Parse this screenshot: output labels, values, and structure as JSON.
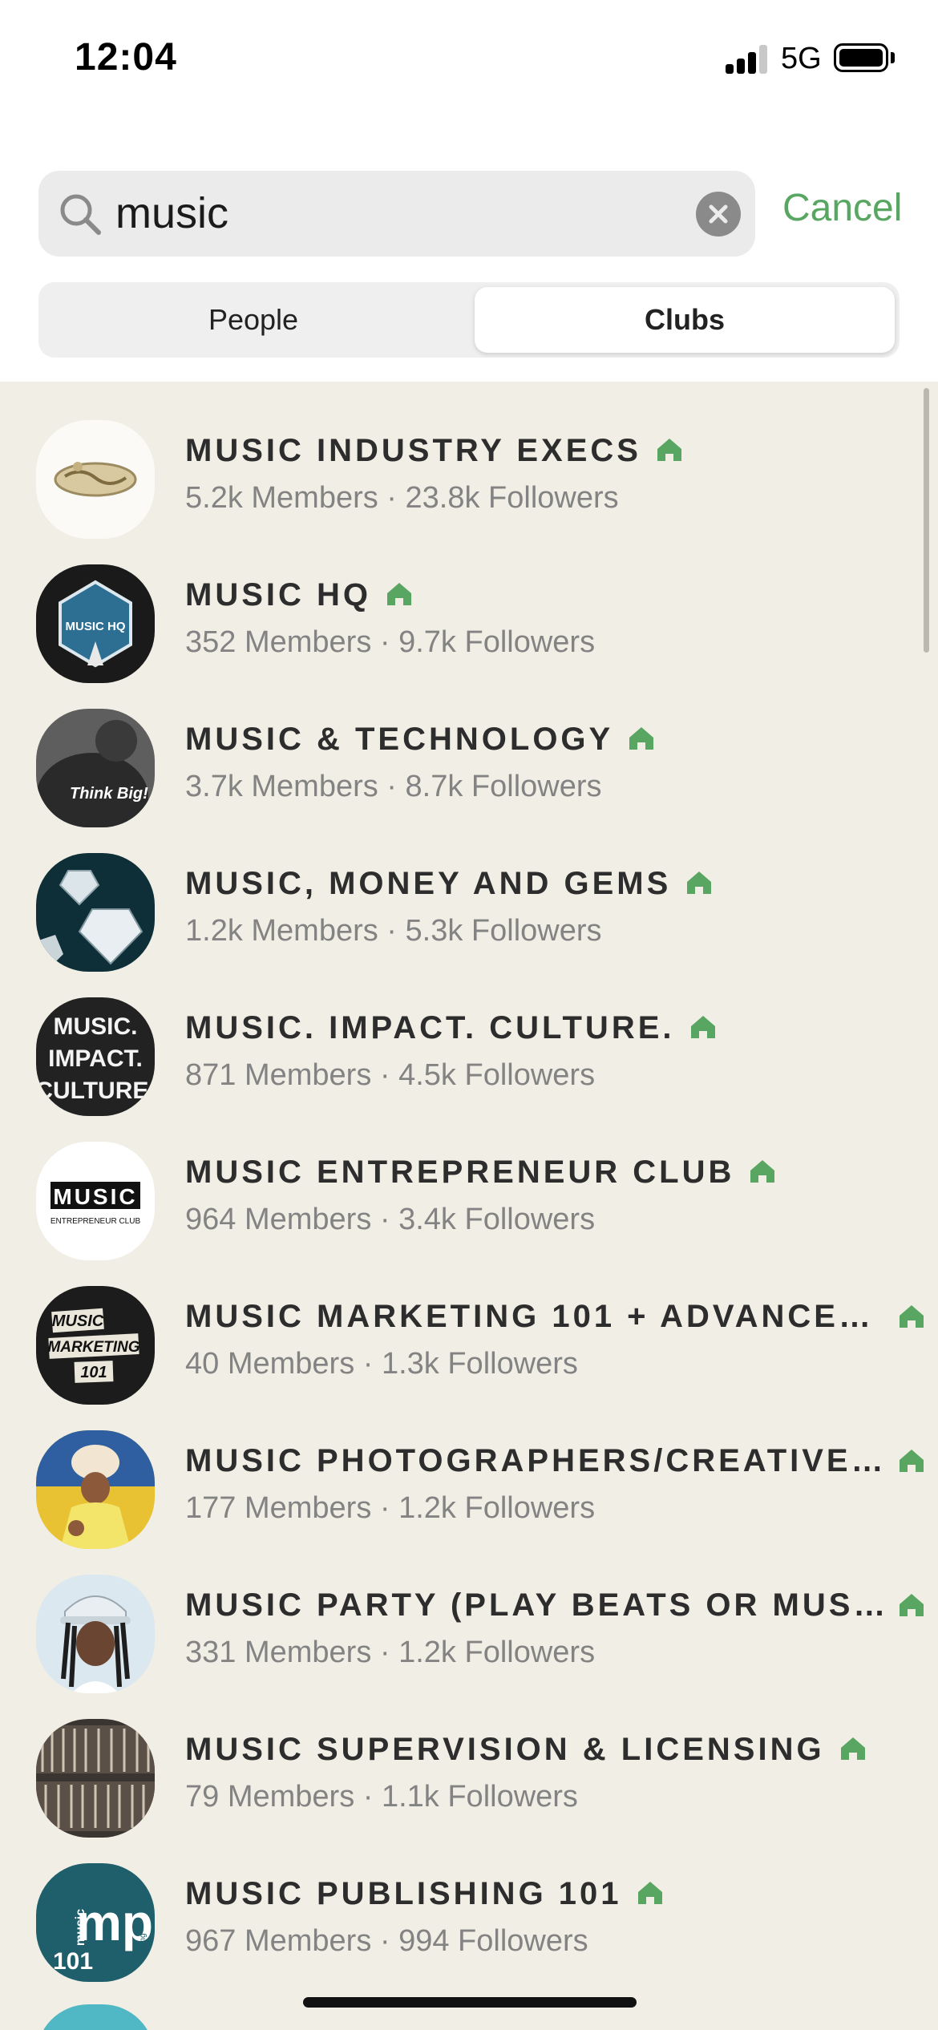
{
  "status_bar": {
    "time": "12:04",
    "network": "5G",
    "signal_bars_filled": 3,
    "battery_icon": "battery-full-icon"
  },
  "search": {
    "value": "music",
    "icon": "search-icon",
    "clear_icon": "clear-icon",
    "cancel_label": "Cancel"
  },
  "tabs": {
    "people": "People",
    "clubs": "Clubs",
    "selected": "Clubs"
  },
  "colors": {
    "accent": "#58A661",
    "background": "#F1EFE5"
  },
  "clubs": [
    {
      "name": "MUSIC INDUSTRY EXECS",
      "stats": "5.2k Members · 23.8k Followers"
    },
    {
      "name": "MUSIC HQ",
      "stats": "352 Members · 9.7k Followers"
    },
    {
      "name": "MUSIC & TECHNOLOGY",
      "stats": "3.7k Members · 8.7k Followers"
    },
    {
      "name": "MUSIC, MONEY AND GEMS",
      "stats": "1.2k Members · 5.3k Followers"
    },
    {
      "name": "MUSIC. IMPACT. CULTURE.",
      "stats": "871 Members · 4.5k Followers"
    },
    {
      "name": "MUSIC ENTREPRENEUR CLUB",
      "stats": "964 Members · 3.4k Followers"
    },
    {
      "name": "MUSIC MARKETING 101 + ADVANCE…",
      "stats": "40 Members · 1.3k Followers"
    },
    {
      "name": "MUSIC PHOTOGRAPHERS/CREATIVE…",
      "stats": "177 Members · 1.2k Followers"
    },
    {
      "name": "MUSIC PARTY (PLAY BEATS OR MUSI…",
      "stats": "331 Members · 1.2k Followers"
    },
    {
      "name": "MUSIC SUPERVISION & LICENSING",
      "stats": "79 Members · 1.1k Followers"
    },
    {
      "name": "MUSIC PUBLISHING 101",
      "stats": "967 Members · 994 Followers"
    }
  ],
  "avatar_text": {
    "music_hq": "MUSIC HQ",
    "think_big": "Think Big!",
    "mic_line1": "MUSIC.",
    "mic_line2": "IMPACT.",
    "mic_line3": "CULTURE.",
    "mec_line1": "MUSIC",
    "mec_line2": "ENTREPRENEUR CLUB",
    "mm_line1": "MUSIC",
    "mm_line2": "MARKETING",
    "mm_line3": "101",
    "mp_line1": "music",
    "mp_line2": "101",
    "mp_line3": "mp",
    "mp_line4": "publishing"
  }
}
